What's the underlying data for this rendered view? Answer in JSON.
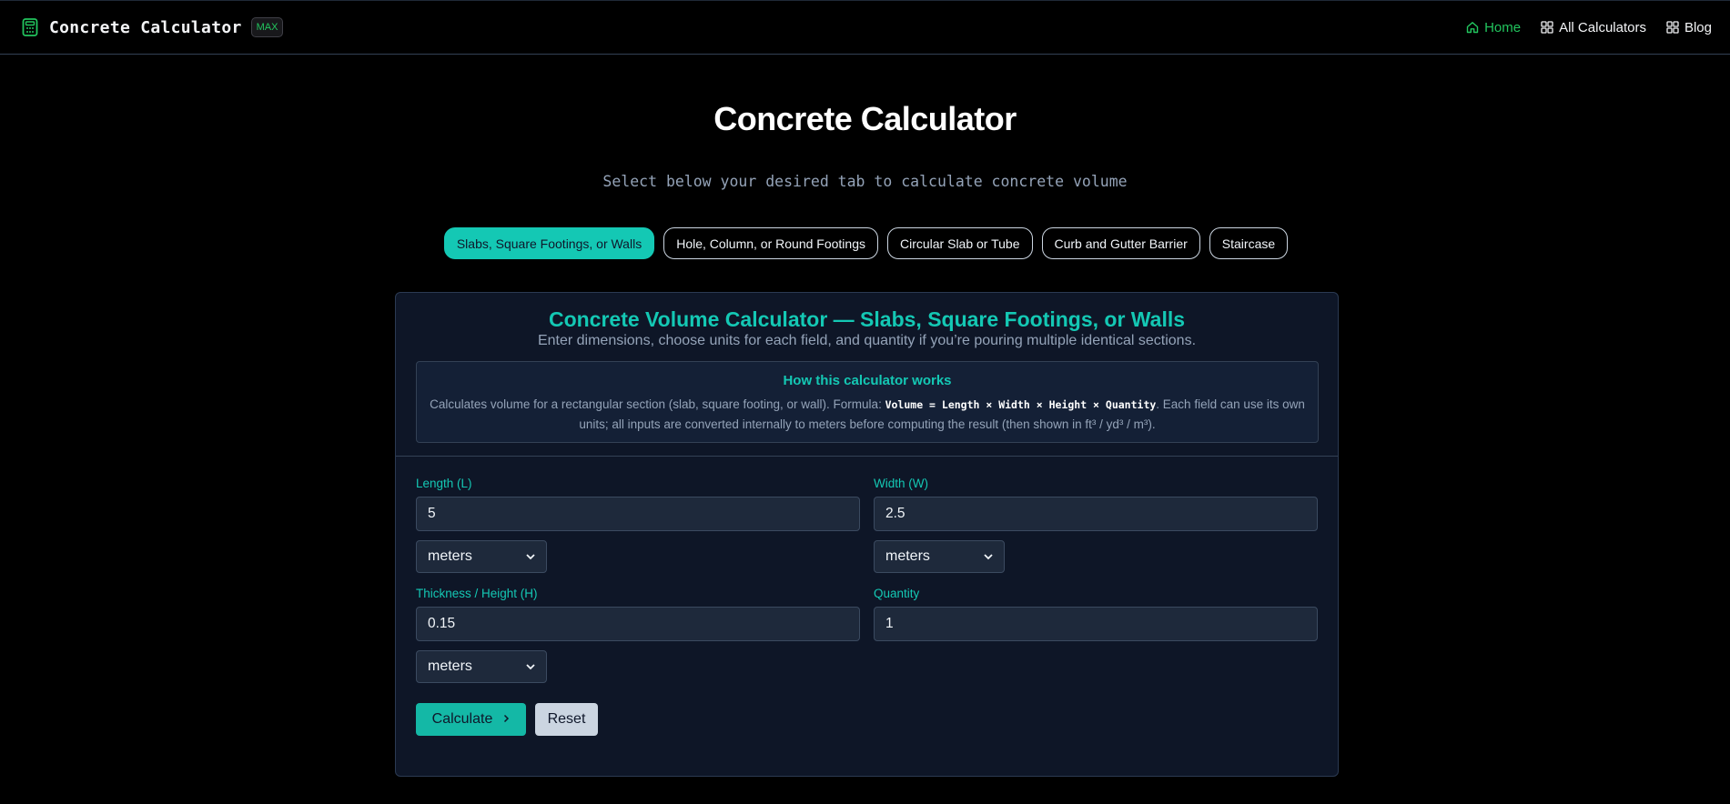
{
  "nav": {
    "brand": "Concrete Calculator",
    "badge": "MAX",
    "links": [
      {
        "label": "Home",
        "icon": "home-icon",
        "active": true
      },
      {
        "label": "All Calculators",
        "icon": "grid-icon",
        "active": false
      },
      {
        "label": "Blog",
        "icon": "grid-icon",
        "active": false
      }
    ]
  },
  "hero": {
    "title": "Concrete Calculator",
    "subtitle": "Select below your desired tab to calculate concrete volume"
  },
  "tabs": [
    {
      "label": "Slabs, Square Footings, or Walls",
      "active": true
    },
    {
      "label": "Hole, Column, or Round Footings",
      "active": false
    },
    {
      "label": "Circular Slab or Tube",
      "active": false
    },
    {
      "label": "Curb and Gutter Barrier",
      "active": false
    },
    {
      "label": "Staircase",
      "active": false
    }
  ],
  "card": {
    "title": "Concrete Volume Calculator — Slabs, Square Footings, or Walls",
    "description": "Enter dimensions, choose units for each field, and quantity if you’re pouring multiple identical sections.",
    "how": {
      "title": "How this calculator works",
      "text_before": "Calculates volume for a rectangular section (slab, square footing, or wall). Formula: ",
      "formula": "Volume = Length × Width × Height × Quantity",
      "text_after": ". Each field can use its own units; all inputs are converted internally to meters before computing the result (then shown in ft³ / yd³ / m³)."
    },
    "fields": {
      "length": {
        "label": "Length (L)",
        "value": "5",
        "unit": "meters"
      },
      "width": {
        "label": "Width (W)",
        "value": "2.5",
        "unit": "meters"
      },
      "height": {
        "label": "Thickness / Height (H)",
        "value": "0.15",
        "unit": "meters"
      },
      "quantity": {
        "label": "Quantity",
        "value": "1"
      }
    },
    "buttons": {
      "calculate": "Calculate",
      "reset": "Reset"
    }
  },
  "colors": {
    "accent": "#14c8b4",
    "nav_active": "#22c55e",
    "background": "#000000",
    "card": "#0e1627"
  }
}
